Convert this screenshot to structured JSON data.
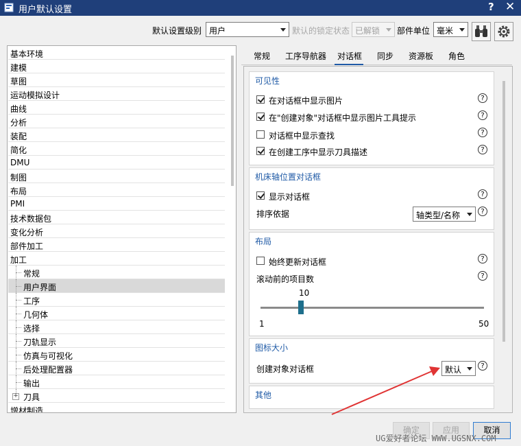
{
  "window": {
    "title": "用户默认设置",
    "help": "?",
    "close": "✕"
  },
  "toolbar": {
    "level_label": "默认设置级别",
    "level_value": "用户",
    "lock_label": "默认的锁定状态",
    "lock_value": "已解锁",
    "unit_label": "部件单位",
    "unit_value": "毫米",
    "binoculars_icon": "binoculars-icon",
    "settings_icon": "gear-icon"
  },
  "nav": {
    "items": [
      "基本环境",
      "建模",
      "草图",
      "运动模拟设计",
      "曲线",
      "分析",
      "装配",
      "简化",
      "DMU",
      "制图",
      "布局",
      "PMI",
      "技术数据包",
      "变化分析",
      "部件加工",
      "加工"
    ],
    "children": [
      "常规",
      "用户界面",
      "工序",
      "几何体",
      "选择",
      "刀轨显示",
      "仿真与可视化",
      "后处理配置器",
      "输出",
      "刀具"
    ],
    "last": "增材制造",
    "selected": "用户界面",
    "expander": "+"
  },
  "tabs": [
    "常规",
    "工序导航器",
    "对话框",
    "同步",
    "资源板",
    "角色"
  ],
  "active_tab": "对话框",
  "visibility": {
    "title": "可见性",
    "options": [
      {
        "label": "在对话框中显示图片",
        "checked": true
      },
      {
        "label": "在\"创建对象\"对话框中显示图片工具提示",
        "checked": true
      },
      {
        "label": "对话框中显示查找",
        "checked": false
      },
      {
        "label": "在创建工序中显示刀具描述",
        "checked": true
      }
    ]
  },
  "axis_dialog": {
    "title": "机床轴位置对话框",
    "show_label": "显示对话框",
    "show_checked": true,
    "sort_label": "排序依据",
    "sort_value": "轴类型/名称"
  },
  "layout_section": {
    "title": "布局",
    "always_update_label": "始终更新对话框",
    "always_update_checked": false,
    "items_label": "滚动前的项目数",
    "slider_value": "10",
    "slider_min": "1",
    "slider_max": "50",
    "slider_fraction": 0.18
  },
  "icon_size": {
    "title": "图标大小",
    "create_label": "创建对象对话框",
    "create_value": "默认"
  },
  "other": {
    "title": "其他"
  },
  "help_glyph": "?",
  "buttons": {
    "ok": "确定",
    "apply": "应用",
    "cancel": "取消"
  },
  "watermark": "UG爱好者论坛 WWW.UGSNX.COM",
  "colors": {
    "titlebar": "#1f3f7a",
    "section_title": "#1f5aa6",
    "arrow": "#e03434",
    "slider_thumb": "#1e6f8c"
  }
}
